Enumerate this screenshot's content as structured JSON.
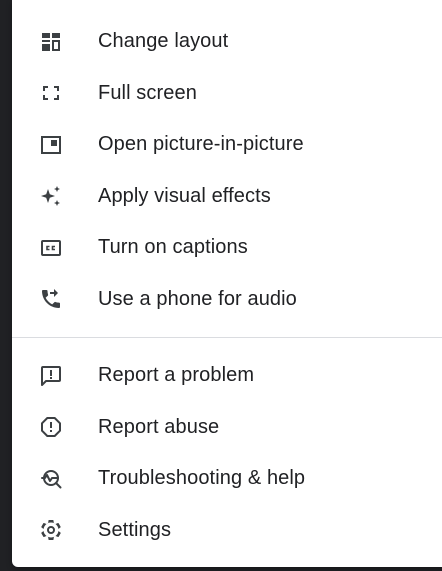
{
  "menu": {
    "primary_items": [
      {
        "label": "Change layout",
        "icon": "change-layout-icon"
      },
      {
        "label": "Full screen",
        "icon": "fullscreen-icon"
      },
      {
        "label": "Open picture-in-picture",
        "icon": "picture-in-picture-icon"
      },
      {
        "label": "Apply visual effects",
        "icon": "sparkle-icon"
      },
      {
        "label": "Turn on captions",
        "icon": "closed-captions-icon"
      },
      {
        "label": "Use a phone for audio",
        "icon": "phone-forwarded-icon"
      }
    ],
    "secondary_items": [
      {
        "label": "Report a problem",
        "icon": "feedback-icon"
      },
      {
        "label": "Report abuse",
        "icon": "report-icon"
      },
      {
        "label": "Troubleshooting & help",
        "icon": "troubleshoot-icon"
      },
      {
        "label": "Settings",
        "icon": "gear-icon"
      }
    ]
  },
  "colors": {
    "text": "#202124",
    "icon": "#3c4043",
    "divider": "#dadce0",
    "background": "#ffffff"
  }
}
